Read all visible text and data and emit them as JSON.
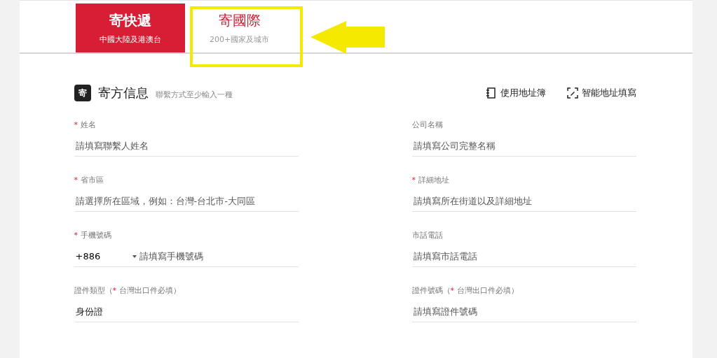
{
  "tabs": [
    {
      "title": "寄快遞",
      "subtitle": "中國大陸及港澳台",
      "selected": true,
      "highlighted": false
    },
    {
      "title": "寄國際",
      "subtitle": "200+國家及城市",
      "selected": false,
      "highlighted": true
    }
  ],
  "section": {
    "badge": "寄",
    "title": "寄方信息",
    "hint": "聯繫方式至少輸入一種",
    "actions": [
      {
        "kind": "book",
        "label": "使用地址簿"
      },
      {
        "kind": "smart",
        "label": "智能地址填寫"
      }
    ]
  },
  "required_mark": "*",
  "fields": [
    {
      "kind": "text",
      "label": "姓名",
      "required": true,
      "placeholder": "請填寫聯繫人姓名"
    },
    {
      "kind": "text",
      "label": "公司名稱",
      "required": false,
      "placeholder": "請填寫公司完整名稱"
    },
    {
      "kind": "text",
      "label": "省市區",
      "required": true,
      "placeholder": "請選擇所在區域，例如：台灣-台北市-大同區"
    },
    {
      "kind": "text",
      "label": "詳細地址",
      "required": true,
      "placeholder": "請填寫所在街道以及詳細地址"
    },
    {
      "kind": "phone",
      "label": "手機號碼",
      "required": true,
      "code": "+886",
      "placeholder": "請填寫手機號碼"
    },
    {
      "kind": "text",
      "label": "市話電話",
      "required": false,
      "placeholder": "請填寫市話電話"
    },
    {
      "kind": "text",
      "label": "證件類型（",
      "label_after": "台灣出口件必填）",
      "required": true,
      "value": "身份證"
    },
    {
      "kind": "text",
      "label": "證件號碼（",
      "label_after": "台灣出口件必填）",
      "required": true,
      "placeholder": "請填寫證件號碼"
    }
  ]
}
